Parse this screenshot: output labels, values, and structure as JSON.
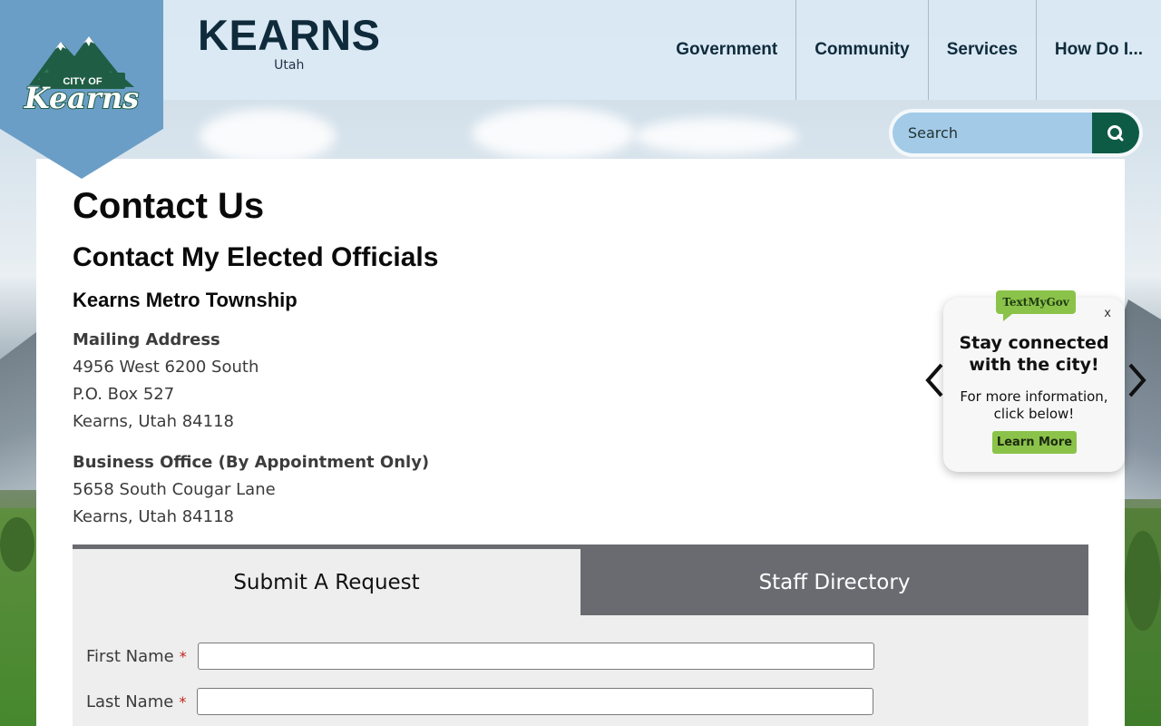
{
  "brand": {
    "title": "KEARNS",
    "subtitle": "Utah",
    "logo_top": "CITY OF",
    "logo_script": "Kearns"
  },
  "nav": {
    "items": [
      "Government",
      "Community",
      "Services",
      "How Do I..."
    ]
  },
  "search": {
    "placeholder": "Search"
  },
  "page": {
    "title": "Contact Us",
    "section_title": "Contact My Elected Officials",
    "sub_title": "Kearns Metro Township"
  },
  "mailing": {
    "label": "Mailing Address",
    "lines": [
      "4956 West 6200 South",
      "P.O. Box 527",
      "Kearns, Utah 84118"
    ]
  },
  "business": {
    "label": "Business Office (By Appointment Only)",
    "lines": [
      "5658 South Cougar Lane",
      "Kearns, Utah 84118"
    ]
  },
  "tabs": [
    "Submit A Request",
    "Staff Directory"
  ],
  "form": {
    "first_name_label": "First Name",
    "last_name_label": "Last Name",
    "required_mark": "*"
  },
  "textmygov": {
    "badge": "TextMyGov",
    "close": "x",
    "heading_line1": "Stay connected",
    "heading_line2": "with the city!",
    "body_line1": "For more information,",
    "body_line2": "click below!",
    "button": "Learn More"
  },
  "colors": {
    "logo_shield": "#6a9ec7",
    "logo_green": "#1f5e44",
    "search_button": "#0e5b45",
    "tab_inactive": "#6a6b70",
    "textmygov_green": "#8bc34a"
  }
}
